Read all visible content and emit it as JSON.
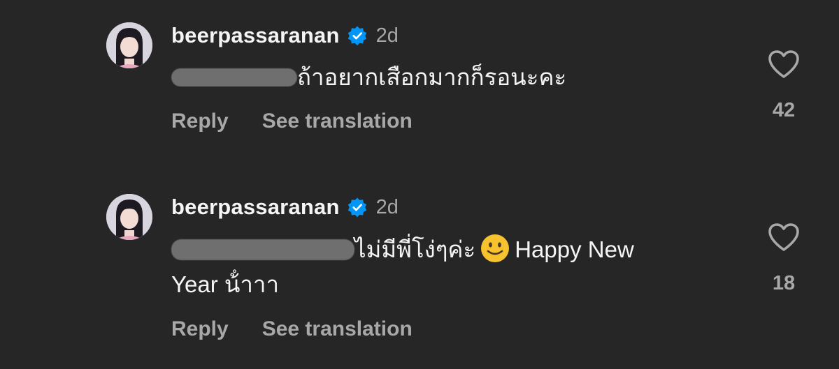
{
  "comments": [
    {
      "username": "beerpassaranan",
      "time": "2d",
      "text": "ถ้าอยากเสือกมากก็รอนะคะ",
      "text_line2": "",
      "reply_label": "Reply",
      "translate_label": "See translation",
      "likes": "42"
    },
    {
      "username": "beerpassaranan",
      "time": "2d",
      "text": "ไม่มีพี่โง่ๆค่ะ",
      "text_after_emoji": "Happy New",
      "text_line2": "Year น้ําาา",
      "reply_label": "Reply",
      "translate_label": "See translation",
      "likes": "18"
    }
  ],
  "icons": {
    "verified": "verified-badge-icon",
    "like": "heart-outline-icon",
    "emoji": "slightly-smiling-face-emoji"
  },
  "colors": {
    "background": "#262626",
    "primary_text": "#f5f5f5",
    "secondary_text": "#a8a8a8",
    "verified_blue": "#0095f6"
  }
}
